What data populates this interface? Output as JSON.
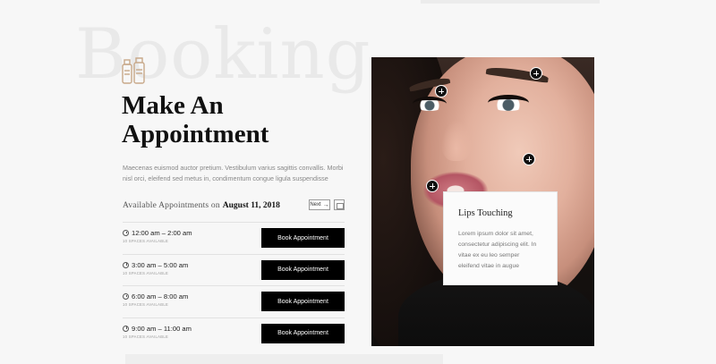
{
  "background_word": "Booking",
  "title": {
    "line1": "Make An",
    "line2": "Appointment"
  },
  "description": "Maecenas euismod auctor pretium. Vestibulum varius sagittis convallis. Morbi nisl orci, eleifend sed metus in, condimentum congue ligula suspendisse",
  "availability": {
    "label": "Available Appointments on",
    "date": "August 11, 2018",
    "next_label": "Next"
  },
  "slots": [
    {
      "time": "12:00 am – 2:00 am",
      "spaces": "10 SPACES AVAILABLE",
      "button": "Book Appointment"
    },
    {
      "time": "3:00 am – 5:00 am",
      "spaces": "10 SPACES AVAILABLE",
      "button": "Book Appointment"
    },
    {
      "time": "6:00 am – 8:00 am",
      "spaces": "10 SPACES AVAILABLE",
      "button": "Book Appointment"
    },
    {
      "time": "9:00 am – 11:00 am",
      "spaces": "10 SPACES AVAILABLE",
      "button": "Book Appointment"
    }
  ],
  "card": {
    "title": "Lips Touching",
    "text": "Lorem ipsum dolor sit amet, consectetur adipiscing elit. In vitae ex eu leo semper eleifend vitae in augue"
  },
  "icons": {
    "logo": "cosmetics-bottles-icon",
    "next": "arrow-right-icon",
    "calendar": "calendar-icon",
    "clock": "clock-icon",
    "hotspot": "plus-hotspot-icon"
  },
  "colors": {
    "background": "#f7f7f7",
    "button": "#000000",
    "logo": "#c8a98a",
    "watermark": "#e9e9e9"
  }
}
